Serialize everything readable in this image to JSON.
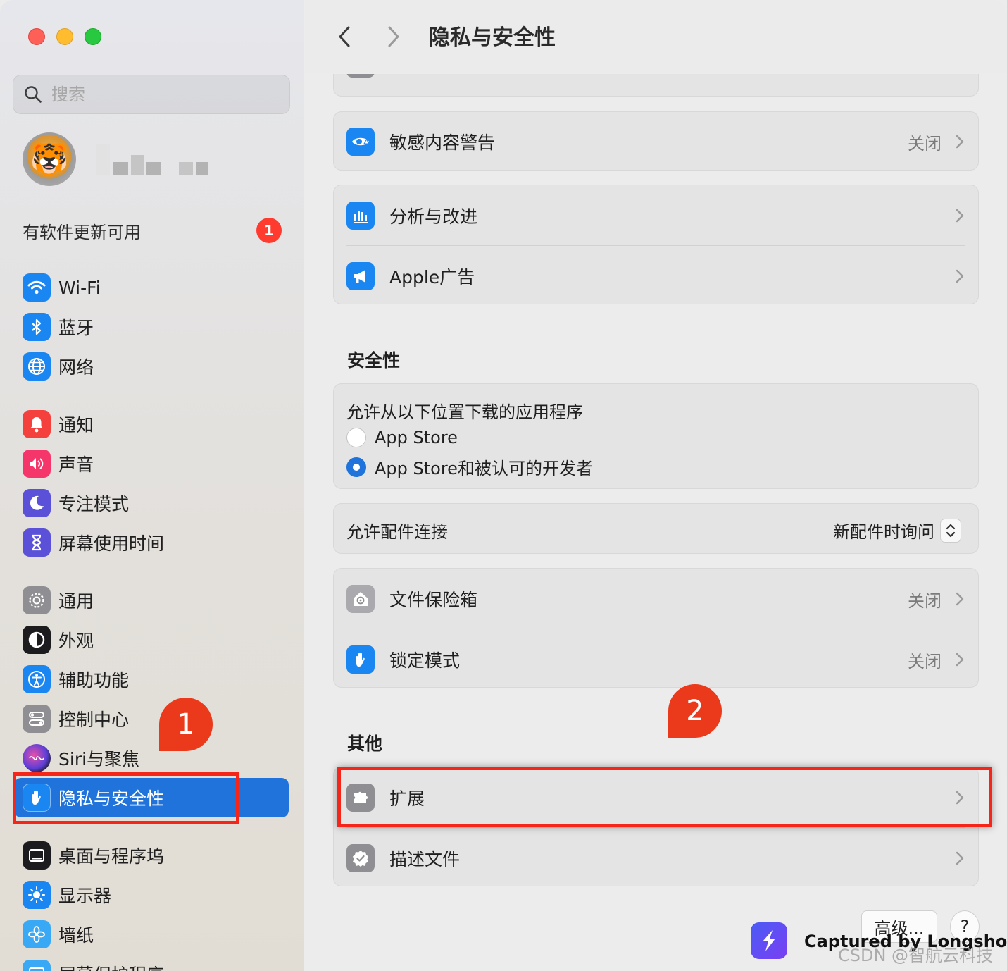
{
  "window": {
    "title": "隐私与安全性"
  },
  "search": {
    "placeholder": "搜索"
  },
  "account": {
    "avatar_icon": "tiger-emoji-avatar"
  },
  "updates": {
    "label": "有软件更新可用",
    "badge": "1"
  },
  "sidebar": {
    "items": [
      {
        "label": "Wi-Fi",
        "icon": "wifi-icon",
        "color": "#1a86f2"
      },
      {
        "label": "蓝牙",
        "icon": "bluetooth-icon",
        "color": "#1a86f2"
      },
      {
        "label": "网络",
        "icon": "globe-icon",
        "color": "#1a86f2"
      },
      {
        "label": "通知",
        "icon": "bell-icon",
        "color": "#f5413d"
      },
      {
        "label": "声音",
        "icon": "speaker-icon",
        "color": "#f5366a"
      },
      {
        "label": "专注模式",
        "icon": "moon-icon",
        "color": "#5b51d8"
      },
      {
        "label": "屏幕使用时间",
        "icon": "hourglass-icon",
        "color": "#5b51d8"
      },
      {
        "label": "通用",
        "icon": "gear-icon",
        "color": "#8e8e93"
      },
      {
        "label": "外观",
        "icon": "appearance-icon",
        "color": "#1c1c1e"
      },
      {
        "label": "辅助功能",
        "icon": "accessibility-icon",
        "color": "#1a86f2"
      },
      {
        "label": "控制中心",
        "icon": "toggles-icon",
        "color": "#8e8e93"
      },
      {
        "label": "Siri与聚焦",
        "icon": "siri-icon",
        "color": "#2d2d2d"
      },
      {
        "label": "隐私与安全性",
        "icon": "hand-icon",
        "color": "#1a86f2"
      },
      {
        "label": "桌面与程序坞",
        "icon": "dock-icon",
        "color": "#1c1c1e"
      },
      {
        "label": "显示器",
        "icon": "sun-icon",
        "color": "#1a86f2"
      },
      {
        "label": "墙纸",
        "icon": "flower-icon",
        "color": "#3aa9f5"
      },
      {
        "label": "屏幕保护程序",
        "icon": "screensaver-icon",
        "color": "#3aa9f5"
      }
    ]
  },
  "content": {
    "sensitive": {
      "label": "敏感内容警告",
      "value": "关闭"
    },
    "analytics": {
      "label": "分析与改进"
    },
    "apple_ads": {
      "label": "Apple广告"
    },
    "security_title": "安全性",
    "allow_apps": {
      "title": "允许从以下位置下载的应用程序",
      "options": [
        "App Store",
        "App Store和被认可的开发者"
      ],
      "selected": 1
    },
    "accessories": {
      "label": "允许配件连接",
      "value": "新配件时询问"
    },
    "filevault": {
      "label": "文件保险箱",
      "value": "关闭"
    },
    "lockdown": {
      "label": "锁定模式",
      "value": "关闭"
    },
    "other_title": "其他",
    "extensions": {
      "label": "扩展"
    },
    "profiles": {
      "label": "描述文件"
    }
  },
  "footer": {
    "advanced": "高级...",
    "help": "?"
  },
  "annotations": {
    "callout_1": "1",
    "callout_2": "2",
    "highlight_color": "#f5251a"
  },
  "overlay": {
    "longshot": "Captured by Longshot",
    "watermark": "CSDN @智航云科技"
  }
}
